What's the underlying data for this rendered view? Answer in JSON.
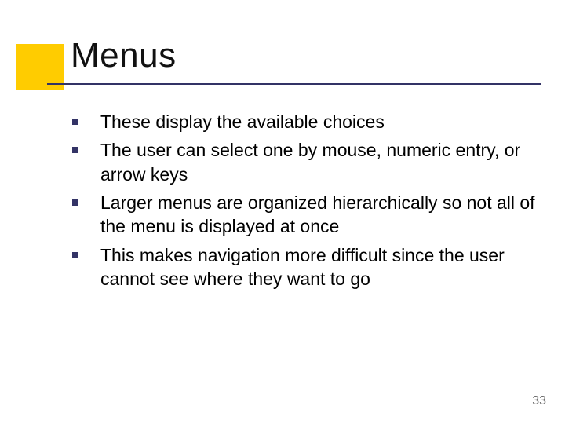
{
  "title": "Menus",
  "bullets": [
    "These display the available choices",
    "The user can select one by mouse, numeric entry, or arrow keys",
    "Larger menus are organized hierarchically so not all of the menu is displayed at once",
    "This makes navigation more difficult since the user cannot see where they want to go"
  ],
  "page_number": "33"
}
